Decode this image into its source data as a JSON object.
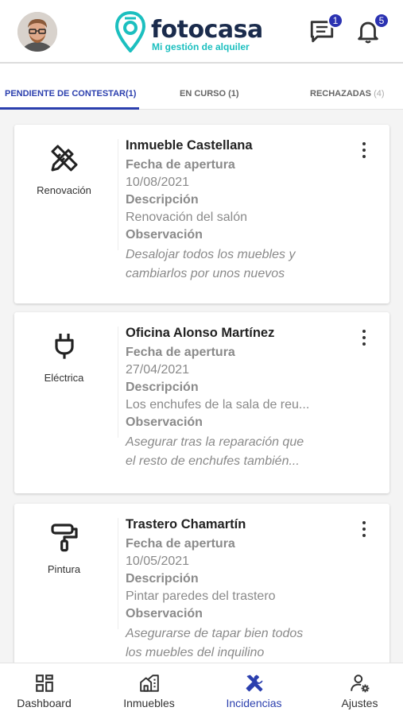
{
  "header": {
    "logo_text": "fotocasa",
    "logo_sub": "Mi gestión de alquiler",
    "messages_badge": "1",
    "notifications_badge": "5"
  },
  "tabs": [
    {
      "label": "PENDIENTE DE CONTESTAR(1)",
      "active": true
    },
    {
      "label": "EN CURSO (1)",
      "active": false
    },
    {
      "label": "RECHAZADAS",
      "count": "(4)",
      "active": false
    }
  ],
  "cards": [
    {
      "category": "Renovación",
      "category_icon": "pencil-ruler-icon",
      "title": "Inmueble Castellana",
      "fecha_label": "Fecha de apertura",
      "fecha": "10/08/2021",
      "desc_label": "Descripción",
      "desc": "Renovación del salón",
      "obs_label": "Observación",
      "obs": "Desalojar todos los muebles y\ncambiarlos por unos nuevos"
    },
    {
      "category": "Eléctrica",
      "category_icon": "plug-icon",
      "title": "Oficina Alonso Martínez",
      "fecha_label": "Fecha de apertura",
      "fecha": "27/04/2021",
      "desc_label": "Descripción",
      "desc": "Los enchufes de la sala de reu...",
      "obs_label": "Observación",
      "obs": "Asegurar tras la reparación que\n el resto de enchufes también..."
    },
    {
      "category": "Pintura",
      "category_icon": "paint-roller-icon",
      "title": "Trastero Chamartín",
      "fecha_label": "Fecha de apertura",
      "fecha": "10/05/2021",
      "desc_label": "Descripción",
      "desc": "Pintar paredes del trastero",
      "obs_label": "Observación",
      "obs": "Asegurarse de tapar bien todos\nlos muebles del inquilino"
    }
  ],
  "bottom_nav": [
    {
      "label": "Dashboard",
      "icon": "dashboard-icon"
    },
    {
      "label": "Inmuebles",
      "icon": "building-icon"
    },
    {
      "label": "Incidencias",
      "icon": "tools-icon",
      "active": true
    },
    {
      "label": "Ajustes",
      "icon": "user-settings-icon"
    }
  ],
  "colors": {
    "accent": "#2b3fae",
    "badge": "#2b32b2",
    "logo_teal": "#1bbfbf",
    "logo_navy": "#1a2b4c",
    "muted_text": "#8a8a8a"
  }
}
